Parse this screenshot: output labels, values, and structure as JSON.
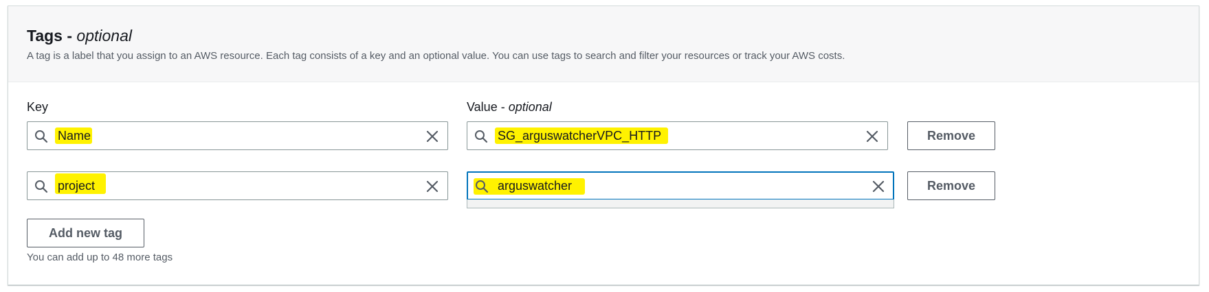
{
  "section": {
    "title": "Tags - ",
    "title_optional": "optional",
    "description": "A tag is a label that you assign to an AWS resource. Each tag consists of a key and an optional value. You can use tags to search and filter your resources or track your AWS costs."
  },
  "labels": {
    "key": "Key",
    "value": "Value - ",
    "value_optional": "optional"
  },
  "tags": [
    {
      "key": "Name",
      "value": "SG_arguswatcherVPC_HTTP",
      "remove_label": "Remove"
    },
    {
      "key": "project",
      "value": "arguswatcher",
      "remove_label": "Remove"
    }
  ],
  "add_button_label": "Add new tag",
  "hint": "You can add up to 48 more tags",
  "icons": {
    "search": "search-icon",
    "clear": "close-icon"
  },
  "colors": {
    "highlight": "#fff200",
    "focus": "#0073bb",
    "border": "#879596"
  }
}
